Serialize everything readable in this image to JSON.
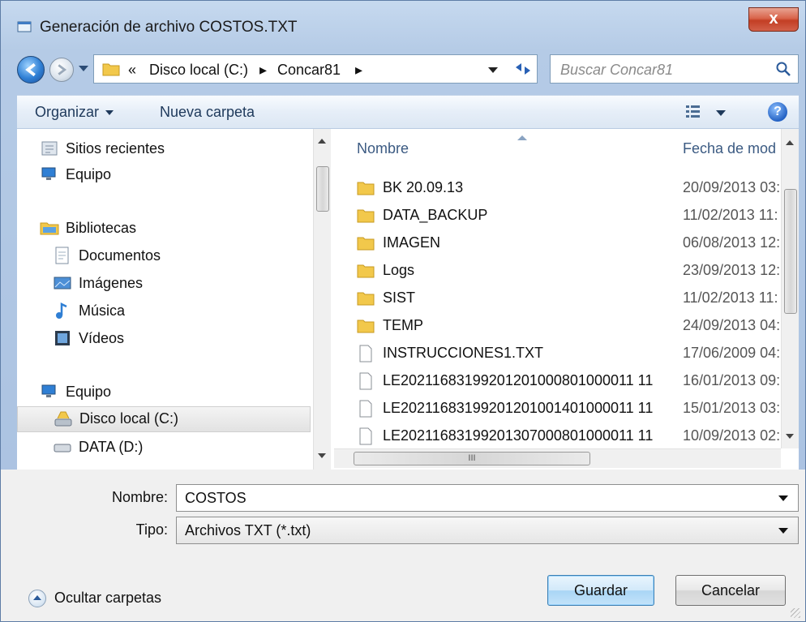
{
  "titlebar": {
    "title": "Generación de archivo COSTOS.TXT",
    "close_label": "x"
  },
  "address": {
    "back_icon": "back-arrow-icon",
    "forward_icon": "forward-arrow-icon",
    "crumbs": [
      "«",
      "Disco local (C:)",
      "▸",
      "Concar81",
      "▸"
    ],
    "search_placeholder": "Buscar Concar81"
  },
  "toolbar": {
    "organize_label": "Organizar",
    "new_folder_label": "Nueva carpeta",
    "help_label": "?"
  },
  "nav": {
    "items": [
      {
        "label": "Sitios recientes",
        "icon": "recent-places-icon"
      },
      {
        "label": "Equipo",
        "icon": "computer-icon"
      },
      {
        "label": "Bibliotecas",
        "icon": "libraries-icon"
      },
      {
        "label": "Documentos",
        "icon": "documents-icon"
      },
      {
        "label": "Imágenes",
        "icon": "pictures-icon"
      },
      {
        "label": "Música",
        "icon": "music-icon"
      },
      {
        "label": "Vídeos",
        "icon": "videos-icon"
      },
      {
        "label": "Equipo",
        "icon": "computer-icon"
      },
      {
        "label": "Disco local (C:)",
        "icon": "drive-icon",
        "selected": true
      },
      {
        "label": "DATA (D:)",
        "icon": "drive-icon"
      }
    ]
  },
  "files": {
    "columns": [
      "Nombre",
      "Fecha de mod"
    ],
    "rows": [
      {
        "name": "BK 20.09.13",
        "date": "20/09/2013 03:",
        "type": "folder"
      },
      {
        "name": "DATA_BACKUP",
        "date": "11/02/2013 11:",
        "type": "folder"
      },
      {
        "name": "IMAGEN",
        "date": "06/08/2013 12:",
        "type": "folder"
      },
      {
        "name": "Logs",
        "date": "23/09/2013 12:",
        "type": "folder"
      },
      {
        "name": "SIST",
        "date": "11/02/2013 11:",
        "type": "folder"
      },
      {
        "name": "TEMP",
        "date": "24/09/2013 04:",
        "type": "folder"
      },
      {
        "name": "INSTRUCCIONES1.TXT",
        "date": "17/06/2009 04:",
        "type": "file"
      },
      {
        "name": "LE20211683199201201000801000011 11",
        "date": "16/01/2013 09:",
        "type": "file"
      },
      {
        "name": "LE20211683199201201001401000011 11",
        "date": "15/01/2013 03:",
        "type": "file"
      },
      {
        "name": "LE20211683199201307000801000011 11",
        "date": "10/09/2013 02:",
        "type": "file"
      }
    ],
    "hscroll_grip": "III"
  },
  "form": {
    "name_label": "Nombre:",
    "name_value": "COSTOS",
    "type_label": "Tipo:",
    "type_value": "Archivos TXT (*.txt)"
  },
  "footer": {
    "hide_folders_label": "Ocultar carpetas",
    "save_label": "Guardar",
    "cancel_label": "Cancelar"
  },
  "colors": {
    "accent": "#3c7fb1",
    "folder": "#f2c84b",
    "title_close": "#c33e24"
  }
}
